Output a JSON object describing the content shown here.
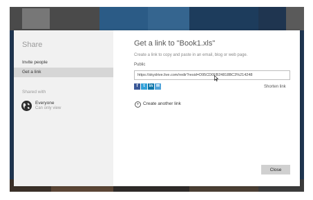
{
  "dialog": {
    "title": "Share",
    "nav_items": [
      {
        "label": "Invite people"
      },
      {
        "label": "Get a link"
      }
    ],
    "shared_with_label": "Shared with",
    "shared_user": {
      "name": "Everyone",
      "permission": "Can only view"
    }
  },
  "main": {
    "title": "Get a link to \"Book1.xls\"",
    "description": "Create a link to copy and paste in an email, blog or web page.",
    "public_label": "Public",
    "link_url": "https://skydrive.live.com/redir?resid=D95CD0FB24818BC3%214248",
    "social_icons": [
      {
        "name": "facebook-icon",
        "glyph": "f",
        "color": "#3b5998"
      },
      {
        "name": "twitter-icon",
        "glyph": "t",
        "color": "#33a1d8"
      },
      {
        "name": "linkedin-icon",
        "glyph": "in",
        "color": "#0e76a8"
      },
      {
        "name": "messenger-icon",
        "glyph": "✉",
        "color": "#4fa3d9"
      }
    ],
    "shorten_link": "Shorten link",
    "create_another_link": "Create another link",
    "close_button": "Close"
  },
  "colors": {
    "backdrop": "#1f3550",
    "sidebar": "#f1f1f1",
    "selected_item": "#d6d6d6"
  }
}
